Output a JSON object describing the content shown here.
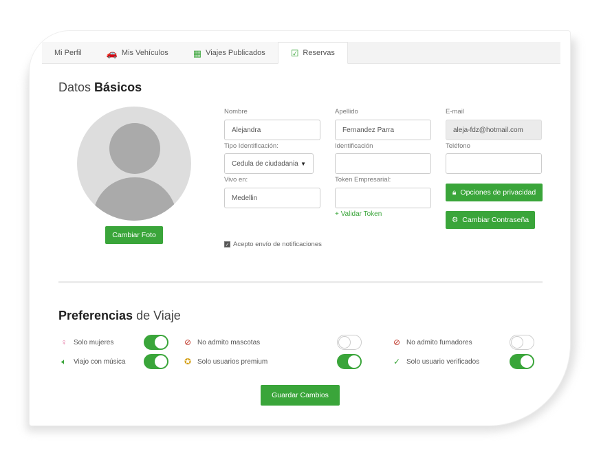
{
  "tabs": [
    {
      "label": "Mi Perfil",
      "icon": "user-icon"
    },
    {
      "label": "Mis Vehículos",
      "icon": "car-icon"
    },
    {
      "label": "Viajes Publicados",
      "icon": "map-icon"
    },
    {
      "label": "Reservas",
      "icon": "check-square-icon"
    }
  ],
  "basic": {
    "title_light": "Datos",
    "title_bold": "Básicos",
    "change_photo": "Cambiar Foto",
    "labels": {
      "nombre": "Nombre",
      "apellido": "Apellido",
      "email": "E-mail",
      "tipo_id": "Tipo Identificación:",
      "identificacion": "Identificación",
      "telefono": "Teléfono",
      "vivo_en": "Vivo en:",
      "token": "Token Empresarial:"
    },
    "values": {
      "nombre": "Alejandra",
      "apellido": "Fernandez Parra",
      "email": "aleja-fdz@hotmail.com",
      "tipo_id": "Cedula de ciudadania",
      "identificacion": "",
      "telefono": "",
      "vivo_en": "Medellin",
      "token": ""
    },
    "validate_token": "Validar Token",
    "privacy_btn": "Opciones de privacidad",
    "password_btn": "Cambiar Contraseña",
    "notifications": "Acepto envío de notificaciones"
  },
  "prefs": {
    "title_bold": "Preferencias",
    "title_light": "de Viaje",
    "items": [
      {
        "label": "Solo mujeres",
        "on": true
      },
      {
        "label": "No admito mascotas",
        "on": false
      },
      {
        "label": "No admito fumadores",
        "on": false
      },
      {
        "label": "Viajo con música",
        "on": true
      },
      {
        "label": "Solo usuarios premium",
        "on": true
      },
      {
        "label": "Solo usuario verificados",
        "on": true
      }
    ]
  },
  "save_btn": "Guardar Cambios",
  "colors": {
    "accent": "#3aa53a"
  }
}
